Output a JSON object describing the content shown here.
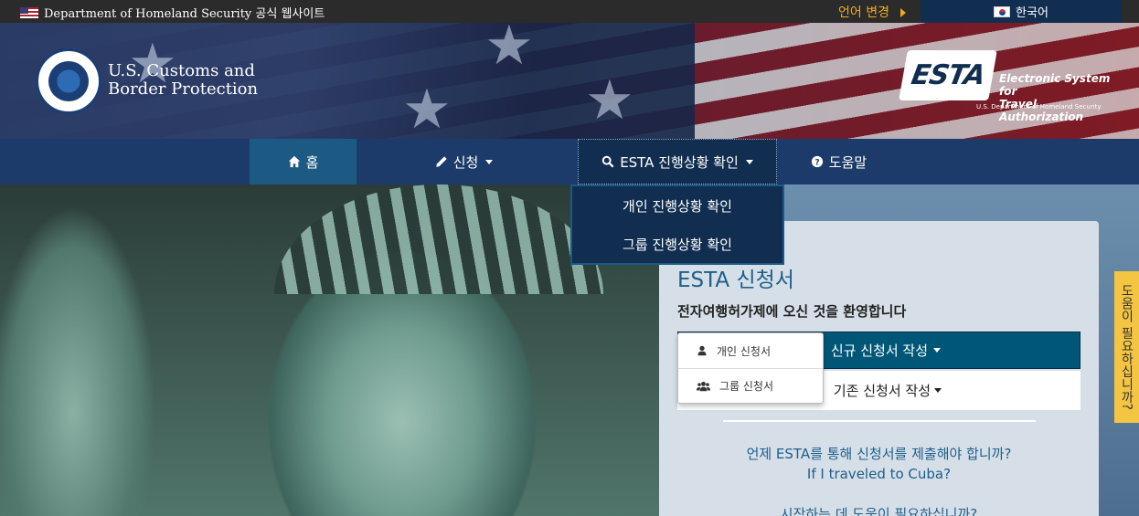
{
  "topbar": {
    "official_text": "Department of Homeland Security 공식 웹사이트",
    "language_change": "언어 변경",
    "current_language": "한국어"
  },
  "header": {
    "agency_line1": "U.S. Customs and",
    "agency_line2": "Border Protection",
    "esta_logo_text": "ESTA",
    "esta_tagline1": "Electronic System for",
    "esta_tagline2": "Travel Authorization",
    "esta_sub": "U.S. Department of Homeland Security"
  },
  "nav": {
    "home": "홈",
    "apply": "신청",
    "status": "ESTA 진행상황 확인",
    "help": "도움말"
  },
  "status_dropdown": {
    "items": [
      "개인 진행상황 확인",
      "그룹 진행상황 확인"
    ]
  },
  "panel": {
    "title": "ESTA 신청서",
    "welcome": "전자여행허가제에 오신 것을 환영합니다",
    "new_application": "신규 신청서 작성",
    "existing_application": "기존 신청서 작성",
    "link_when": "언제 ESTA를 통해 신청서를 제출해야 합니까?",
    "link_cuba": "If I traveled to Cuba?",
    "link_help_start": "시작하는 데 도움이 필요하십니까?"
  },
  "application_dropdown": {
    "individual": "개인 신청서",
    "group": "그룹 신청서"
  },
  "help_tab": "도움이 필요하십니까?",
  "colors": {
    "nav_bg": "#1d3b6a",
    "nav_active": "#1c5a84",
    "primary_button": "#005677",
    "link": "#1d5f8a",
    "help_tab": "#f4c542"
  }
}
